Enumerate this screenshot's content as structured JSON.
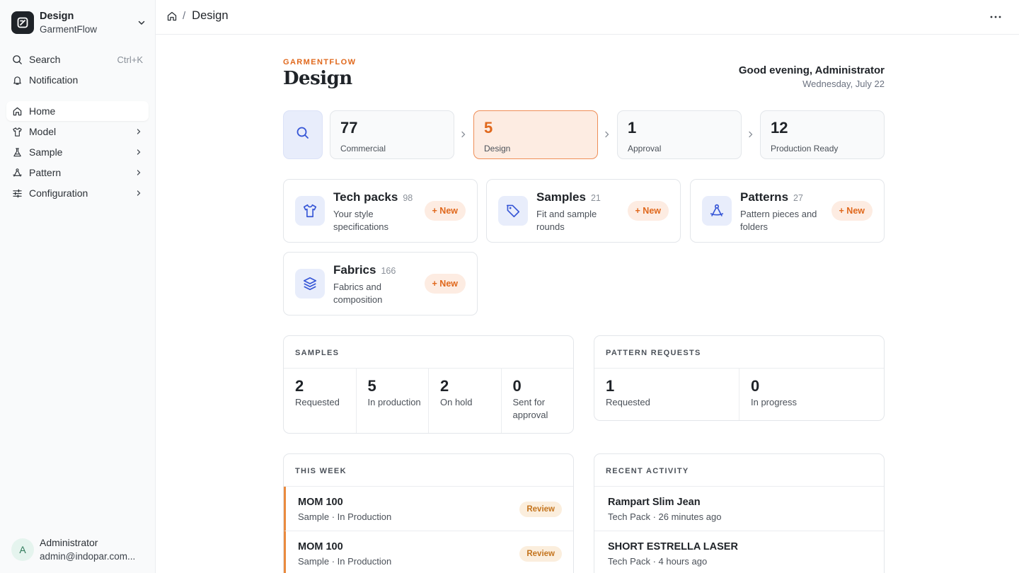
{
  "workspace": {
    "title": "Design",
    "subtitle": "GarmentFlow"
  },
  "sidebar": {
    "search": {
      "label": "Search",
      "shortcut": "Ctrl+K"
    },
    "notification": {
      "label": "Notification"
    },
    "items": [
      {
        "label": "Home",
        "icon": "home-icon",
        "active": true
      },
      {
        "label": "Model",
        "icon": "shirt-icon"
      },
      {
        "label": "Sample",
        "icon": "flask-icon"
      },
      {
        "label": "Pattern",
        "icon": "compass-icon"
      },
      {
        "label": "Configuration",
        "icon": "sliders-icon"
      }
    ]
  },
  "user": {
    "initial": "A",
    "name": "Administrator",
    "email": "admin@indopar.com..."
  },
  "breadcrumb": {
    "separator": "/",
    "current": "Design"
  },
  "header": {
    "eyebrow": "GARMENTFLOW",
    "title": "Design",
    "greeting": "Good evening, Administrator",
    "date": "Wednesday, July 22"
  },
  "pipeline": [
    {
      "count": "77",
      "label": "Commercial"
    },
    {
      "count": "5",
      "label": "Design",
      "active": true
    },
    {
      "count": "1",
      "label": "Approval"
    },
    {
      "count": "12",
      "label": "Production Ready"
    }
  ],
  "modules": [
    {
      "title": "Tech packs",
      "count": "98",
      "desc": "Your style specifications",
      "button": "+ New",
      "icon": "shirt-icon"
    },
    {
      "title": "Samples",
      "count": "21",
      "desc": "Fit and sample rounds",
      "button": "+ New",
      "icon": "tag-icon"
    },
    {
      "title": "Patterns",
      "count": "27",
      "desc": "Pattern pieces and folders",
      "button": "+ New",
      "icon": "compass-icon"
    },
    {
      "title": "Fabrics",
      "count": "166",
      "desc": "Fabrics and composition",
      "button": "+ New",
      "icon": "layers-icon"
    }
  ],
  "samples_panel": {
    "title": "SAMPLES",
    "stats": [
      {
        "value": "2",
        "label": "Requested"
      },
      {
        "value": "5",
        "label": "In production"
      },
      {
        "value": "2",
        "label": "On hold"
      },
      {
        "value": "0",
        "label": "Sent for approval"
      }
    ]
  },
  "pattern_panel": {
    "title": "PATTERN REQUESTS",
    "stats": [
      {
        "value": "1",
        "label": "Requested"
      },
      {
        "value": "0",
        "label": "In progress"
      }
    ]
  },
  "this_week": {
    "title": "THIS WEEK",
    "items": [
      {
        "title": "MOM 100",
        "subtitle": "Sample · In Production",
        "badge": "Review"
      },
      {
        "title": "MOM 100",
        "subtitle": "Sample · In Production",
        "badge": "Review"
      }
    ]
  },
  "recent_activity": {
    "title": "RECENT ACTIVITY",
    "items": [
      {
        "title": "Rampart Slim Jean",
        "subtitle": "Tech Pack · 26 minutes ago"
      },
      {
        "title": "SHORT ESTRELLA LASER",
        "subtitle": "Tech Pack · 4 hours ago"
      }
    ]
  },
  "colors": {
    "accent": "#e0681c",
    "accent_soft": "#fdece2",
    "icon_tile": "#e8edfb",
    "icon_blue": "#3656d6"
  }
}
